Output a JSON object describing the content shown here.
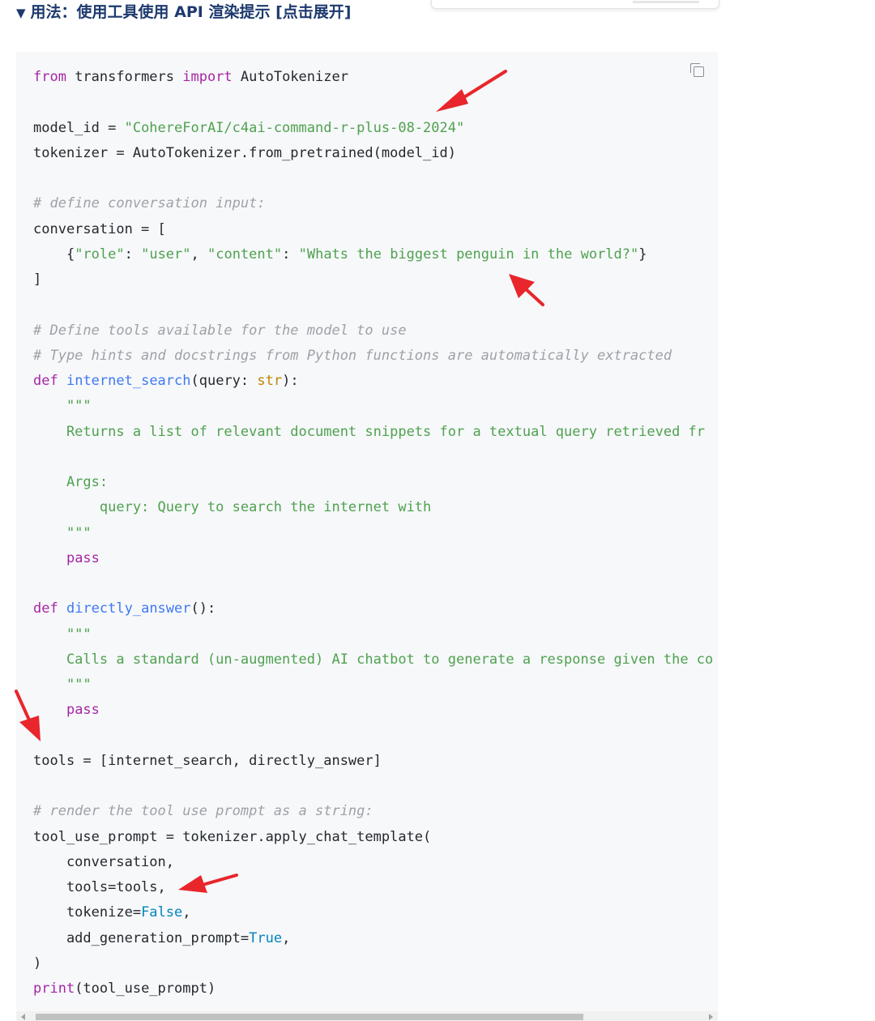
{
  "summary": {
    "triangle": "▼",
    "title": "用法：使用工具使用 API 渲染提示 [点击展开]"
  },
  "colors": {
    "keyword": "#a626a4",
    "string": "#50a14f",
    "comment": "#a0a1a7",
    "function": "#4078f2",
    "annotation_arrows": "#e8262b"
  },
  "code": {
    "l1": {
      "kw_from": "from",
      "mod": " transformers ",
      "kw_import": "import",
      "name": " AutoTokenizer"
    },
    "l3": {
      "left": "model_id = ",
      "str": "\"CohereForAI/c4ai-command-r-plus-08-2024\""
    },
    "l4": "tokenizer = AutoTokenizer.from_pretrained(model_id)",
    "l6": "# define conversation input:",
    "l7": "conversation = [",
    "l8": {
      "indent": "    {",
      "k1": "\"role\"",
      "sep1": ": ",
      "v1": "\"user\"",
      "sep2": ", ",
      "k2": "\"content\"",
      "sep3": ": ",
      "v2": "\"Whats the biggest penguin in the world?\"",
      "end": "}"
    },
    "l9": "]",
    "l11": "# Define tools available for the model to use",
    "l12": "# Type hints and docstrings from Python functions are automatically extracted",
    "l13": {
      "kw": "def",
      "fn": "internet_search",
      "open": "(query: ",
      "type": "str",
      "close": "):"
    },
    "l14": "    \"\"\"",
    "l15": "    Returns a list of relevant document snippets for a textual query retrieved fr",
    "l17": "    Args:",
    "l18": "        query: Query to search the internet with",
    "l19": "    \"\"\"",
    "l20": "pass",
    "l22": {
      "kw": "def",
      "fn": "directly_answer",
      "rest": "():"
    },
    "l23": "    \"\"\"",
    "l24": "    Calls a standard (un-augmented) AI chatbot to generate a response given the co",
    "l25": "    \"\"\"",
    "l26": "pass",
    "l28": "tools = [internet_search, directly_answer]",
    "l30": "# render the tool use prompt as a string:",
    "l31": "tool_use_prompt = tokenizer.apply_chat_template(",
    "l32": "    conversation,",
    "l33": "    tools=tools,",
    "l34": {
      "left": "    tokenize=",
      "lit": "False",
      "end": ","
    },
    "l35": {
      "left": "    add_generation_prompt=",
      "lit": "True",
      "end": ","
    },
    "l36": ")",
    "l37": {
      "fn": "print",
      "rest": "(tool_use_prompt)"
    }
  }
}
